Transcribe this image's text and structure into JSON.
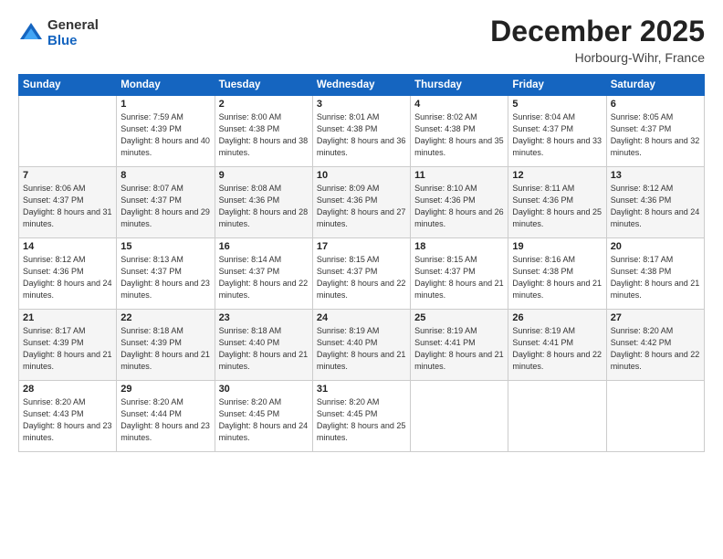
{
  "header": {
    "logo_general": "General",
    "logo_blue": "Blue",
    "month_title": "December 2025",
    "subtitle": "Horbourg-Wihr, France"
  },
  "weekdays": [
    "Sunday",
    "Monday",
    "Tuesday",
    "Wednesday",
    "Thursday",
    "Friday",
    "Saturday"
  ],
  "weeks": [
    [
      {
        "day": "",
        "sunrise": "",
        "sunset": "",
        "daylight": ""
      },
      {
        "day": "1",
        "sunrise": "Sunrise: 7:59 AM",
        "sunset": "Sunset: 4:39 PM",
        "daylight": "Daylight: 8 hours and 40 minutes."
      },
      {
        "day": "2",
        "sunrise": "Sunrise: 8:00 AM",
        "sunset": "Sunset: 4:38 PM",
        "daylight": "Daylight: 8 hours and 38 minutes."
      },
      {
        "day": "3",
        "sunrise": "Sunrise: 8:01 AM",
        "sunset": "Sunset: 4:38 PM",
        "daylight": "Daylight: 8 hours and 36 minutes."
      },
      {
        "day": "4",
        "sunrise": "Sunrise: 8:02 AM",
        "sunset": "Sunset: 4:38 PM",
        "daylight": "Daylight: 8 hours and 35 minutes."
      },
      {
        "day": "5",
        "sunrise": "Sunrise: 8:04 AM",
        "sunset": "Sunset: 4:37 PM",
        "daylight": "Daylight: 8 hours and 33 minutes."
      },
      {
        "day": "6",
        "sunrise": "Sunrise: 8:05 AM",
        "sunset": "Sunset: 4:37 PM",
        "daylight": "Daylight: 8 hours and 32 minutes."
      }
    ],
    [
      {
        "day": "7",
        "sunrise": "Sunrise: 8:06 AM",
        "sunset": "Sunset: 4:37 PM",
        "daylight": "Daylight: 8 hours and 31 minutes."
      },
      {
        "day": "8",
        "sunrise": "Sunrise: 8:07 AM",
        "sunset": "Sunset: 4:37 PM",
        "daylight": "Daylight: 8 hours and 29 minutes."
      },
      {
        "day": "9",
        "sunrise": "Sunrise: 8:08 AM",
        "sunset": "Sunset: 4:36 PM",
        "daylight": "Daylight: 8 hours and 28 minutes."
      },
      {
        "day": "10",
        "sunrise": "Sunrise: 8:09 AM",
        "sunset": "Sunset: 4:36 PM",
        "daylight": "Daylight: 8 hours and 27 minutes."
      },
      {
        "day": "11",
        "sunrise": "Sunrise: 8:10 AM",
        "sunset": "Sunset: 4:36 PM",
        "daylight": "Daylight: 8 hours and 26 minutes."
      },
      {
        "day": "12",
        "sunrise": "Sunrise: 8:11 AM",
        "sunset": "Sunset: 4:36 PM",
        "daylight": "Daylight: 8 hours and 25 minutes."
      },
      {
        "day": "13",
        "sunrise": "Sunrise: 8:12 AM",
        "sunset": "Sunset: 4:36 PM",
        "daylight": "Daylight: 8 hours and 24 minutes."
      }
    ],
    [
      {
        "day": "14",
        "sunrise": "Sunrise: 8:12 AM",
        "sunset": "Sunset: 4:36 PM",
        "daylight": "Daylight: 8 hours and 24 minutes."
      },
      {
        "day": "15",
        "sunrise": "Sunrise: 8:13 AM",
        "sunset": "Sunset: 4:37 PM",
        "daylight": "Daylight: 8 hours and 23 minutes."
      },
      {
        "day": "16",
        "sunrise": "Sunrise: 8:14 AM",
        "sunset": "Sunset: 4:37 PM",
        "daylight": "Daylight: 8 hours and 22 minutes."
      },
      {
        "day": "17",
        "sunrise": "Sunrise: 8:15 AM",
        "sunset": "Sunset: 4:37 PM",
        "daylight": "Daylight: 8 hours and 22 minutes."
      },
      {
        "day": "18",
        "sunrise": "Sunrise: 8:15 AM",
        "sunset": "Sunset: 4:37 PM",
        "daylight": "Daylight: 8 hours and 21 minutes."
      },
      {
        "day": "19",
        "sunrise": "Sunrise: 8:16 AM",
        "sunset": "Sunset: 4:38 PM",
        "daylight": "Daylight: 8 hours and 21 minutes."
      },
      {
        "day": "20",
        "sunrise": "Sunrise: 8:17 AM",
        "sunset": "Sunset: 4:38 PM",
        "daylight": "Daylight: 8 hours and 21 minutes."
      }
    ],
    [
      {
        "day": "21",
        "sunrise": "Sunrise: 8:17 AM",
        "sunset": "Sunset: 4:39 PM",
        "daylight": "Daylight: 8 hours and 21 minutes."
      },
      {
        "day": "22",
        "sunrise": "Sunrise: 8:18 AM",
        "sunset": "Sunset: 4:39 PM",
        "daylight": "Daylight: 8 hours and 21 minutes."
      },
      {
        "day": "23",
        "sunrise": "Sunrise: 8:18 AM",
        "sunset": "Sunset: 4:40 PM",
        "daylight": "Daylight: 8 hours and 21 minutes."
      },
      {
        "day": "24",
        "sunrise": "Sunrise: 8:19 AM",
        "sunset": "Sunset: 4:40 PM",
        "daylight": "Daylight: 8 hours and 21 minutes."
      },
      {
        "day": "25",
        "sunrise": "Sunrise: 8:19 AM",
        "sunset": "Sunset: 4:41 PM",
        "daylight": "Daylight: 8 hours and 21 minutes."
      },
      {
        "day": "26",
        "sunrise": "Sunrise: 8:19 AM",
        "sunset": "Sunset: 4:41 PM",
        "daylight": "Daylight: 8 hours and 22 minutes."
      },
      {
        "day": "27",
        "sunrise": "Sunrise: 8:20 AM",
        "sunset": "Sunset: 4:42 PM",
        "daylight": "Daylight: 8 hours and 22 minutes."
      }
    ],
    [
      {
        "day": "28",
        "sunrise": "Sunrise: 8:20 AM",
        "sunset": "Sunset: 4:43 PM",
        "daylight": "Daylight: 8 hours and 23 minutes."
      },
      {
        "day": "29",
        "sunrise": "Sunrise: 8:20 AM",
        "sunset": "Sunset: 4:44 PM",
        "daylight": "Daylight: 8 hours and 23 minutes."
      },
      {
        "day": "30",
        "sunrise": "Sunrise: 8:20 AM",
        "sunset": "Sunset: 4:45 PM",
        "daylight": "Daylight: 8 hours and 24 minutes."
      },
      {
        "day": "31",
        "sunrise": "Sunrise: 8:20 AM",
        "sunset": "Sunset: 4:45 PM",
        "daylight": "Daylight: 8 hours and 25 minutes."
      },
      {
        "day": "",
        "sunrise": "",
        "sunset": "",
        "daylight": ""
      },
      {
        "day": "",
        "sunrise": "",
        "sunset": "",
        "daylight": ""
      },
      {
        "day": "",
        "sunrise": "",
        "sunset": "",
        "daylight": ""
      }
    ]
  ]
}
